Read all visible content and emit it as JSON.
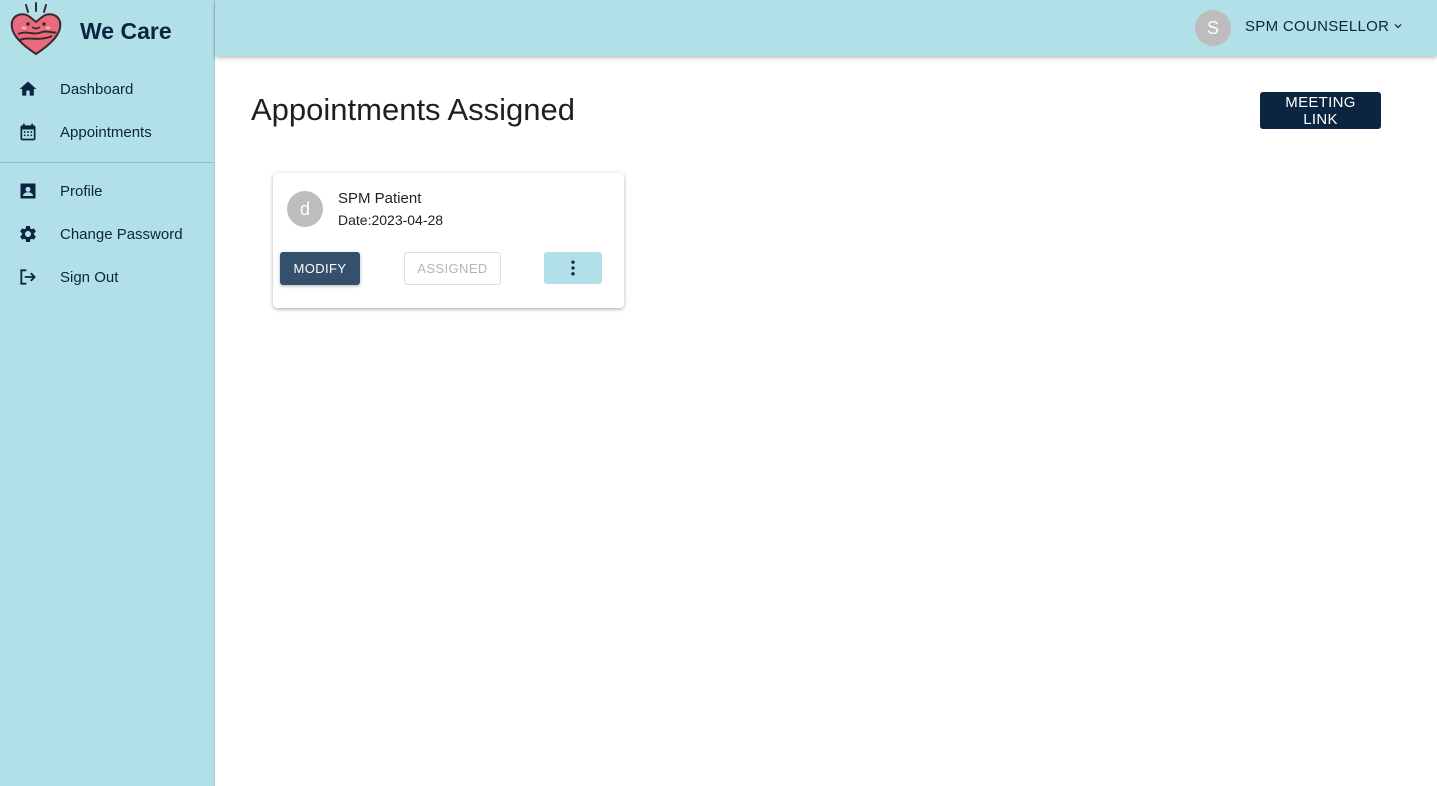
{
  "brand": {
    "name": "We Care",
    "logo_icon": "heart-hug-logo"
  },
  "sidebar": {
    "primary": [
      {
        "label": "Dashboard",
        "icon": "home-icon"
      },
      {
        "label": "Appointments",
        "icon": "calendar-icon"
      }
    ],
    "secondary": [
      {
        "label": "Profile",
        "icon": "contact-card-icon"
      },
      {
        "label": "Change Password",
        "icon": "gear-icon"
      },
      {
        "label": "Sign Out",
        "icon": "logout-icon"
      }
    ]
  },
  "header": {
    "user_initial": "S",
    "user_name": "SPM COUNSELLOR",
    "menu_icon": "chevron-down-icon"
  },
  "main": {
    "title": "Appointments Assigned",
    "meeting_link_label": "MEETING LINK"
  },
  "appointments": [
    {
      "avatar_initial": "d",
      "name": "SPM Patient",
      "date_label": "Date:",
      "date": "2023-04-28",
      "modify_label": "MODIFY",
      "status_label": "ASSIGNED",
      "more_icon": "more-vertical-icon"
    }
  ],
  "colors": {
    "sidebar_bg": "#b2e0e8",
    "header_bg": "#b2e0e8",
    "primary_dark": "#0b2540",
    "modify_button": "#34506b",
    "logo_pink": "#e86a7e"
  }
}
